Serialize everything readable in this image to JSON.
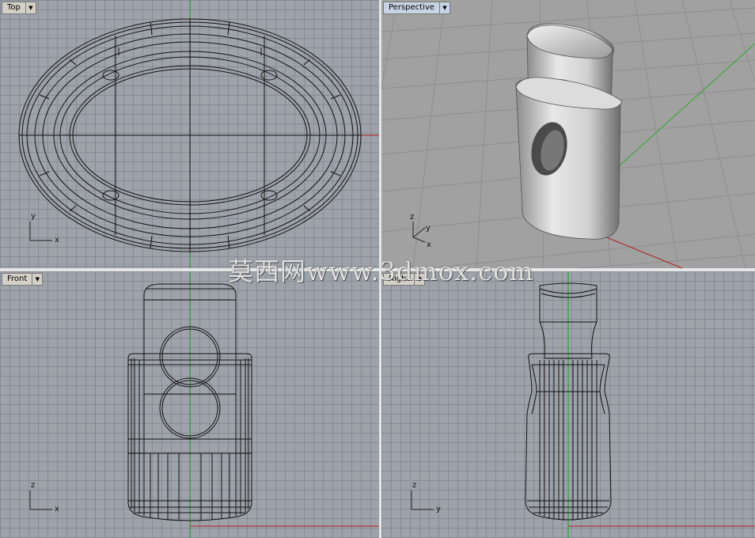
{
  "viewports": {
    "top": {
      "label": "Top",
      "axis_x": "x",
      "axis_y": "y"
    },
    "perspective": {
      "label": "Perspective",
      "axis_x": "x",
      "axis_y": "y",
      "axis_z": "z"
    },
    "front": {
      "label": "Front",
      "axis_x": "x",
      "axis_y": "z"
    },
    "right": {
      "label": "Right",
      "axis_x": "y",
      "axis_y": "z"
    }
  },
  "watermark": "莫西网www.3dmox.com",
  "colors": {
    "viewport_bg": "#9ea3aa",
    "grid_line": "#858991",
    "axis_x": "#b02020",
    "axis_y": "#1f9a1f",
    "wire": "#111111",
    "active_tab": "#c8d4e4"
  },
  "icons": {
    "viewport_menu": "triangle-down-icon"
  }
}
